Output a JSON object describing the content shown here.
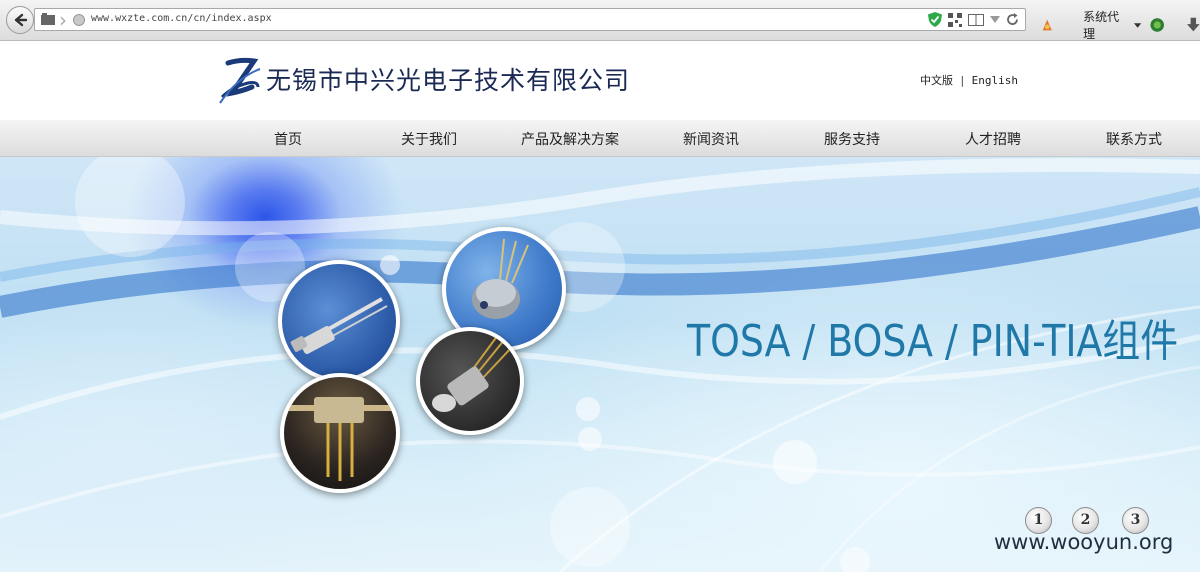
{
  "browser": {
    "url": "www.wxzte.com.cn/cn/index.aspx",
    "proxy_label": "系统代理"
  },
  "header": {
    "company_name": "无锡市中兴光电子技术有限公司",
    "lang_cn": "中文版",
    "lang_sep": "|",
    "lang_en": "English"
  },
  "nav": {
    "items": [
      {
        "label": "首页"
      },
      {
        "label": "关于我们"
      },
      {
        "label": "产品及解决方案"
      },
      {
        "label": "新闻资讯"
      },
      {
        "label": "服务支持"
      },
      {
        "label": "人才招聘"
      },
      {
        "label": "联系方式"
      }
    ]
  },
  "banner": {
    "title": "TOSA / BOSA / PIN-TIA组件",
    "pager": [
      "1",
      "2",
      "3"
    ],
    "active_page": 1
  },
  "watermark": "www.wooyun.org",
  "colors": {
    "banner_title": "#1f78a8",
    "company_name": "#1b2a55"
  }
}
